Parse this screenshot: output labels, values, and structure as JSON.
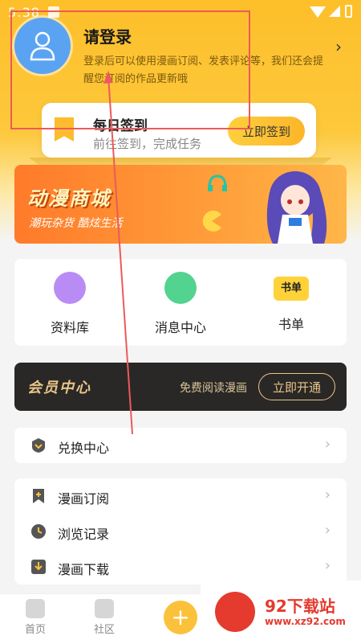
{
  "status_bar": {
    "time": "5:38"
  },
  "header": {
    "login_title": "请登录",
    "login_desc": "登录后可以使用漫画订阅、发表评论等，我们还会提醒您订阅的作品更新哦"
  },
  "sign_in": {
    "title": "每日签到",
    "subtitle": "前往签到，完成任务",
    "button": "立即签到"
  },
  "banner": {
    "title": "动漫商城",
    "subtitle": "潮玩杂货 酷炫生活"
  },
  "quick_links": [
    {
      "label": "资料库",
      "icon": "library-icon",
      "color": "#b98cf5"
    },
    {
      "label": "消息中心",
      "icon": "message-center-icon",
      "color": "#52d38f"
    },
    {
      "label": "书单",
      "icon": "booklist-icon",
      "color": "#ffd23a",
      "badge": "书单"
    }
  ],
  "vip": {
    "title": "会员中心",
    "subtitle": "免费阅读漫画",
    "button": "立即开通"
  },
  "menu_group_1": [
    {
      "label": "兑换中心",
      "icon": "exchange-icon"
    }
  ],
  "menu_group_2": [
    {
      "label": "漫画订阅",
      "icon": "subscribe-icon"
    },
    {
      "label": "浏览记录",
      "icon": "history-icon"
    },
    {
      "label": "漫画下载",
      "icon": "download-icon"
    }
  ],
  "bottom_nav": {
    "home": "首页",
    "community": "社区"
  },
  "watermark": {
    "text": "92下载站",
    "url": "www.xz92.com"
  },
  "colors": {
    "accent": "#fcc13a",
    "annotation": "#ec5a5a"
  }
}
